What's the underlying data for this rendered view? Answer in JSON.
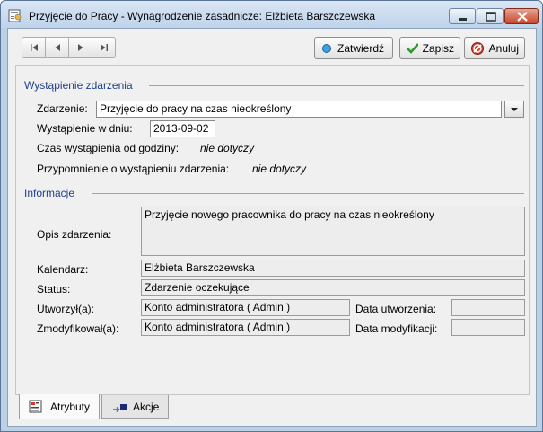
{
  "window": {
    "title": "Przyjęcie do Pracy - Wynagrodzenie zasadnicze:  Elżbieta Barszczewska",
    "minimize_icon": "minimize-icon",
    "maximize_icon": "maximize-icon",
    "close_icon": "close-icon"
  },
  "toolbar": {
    "confirm_label": "Zatwierdź",
    "save_label": "Zapisz",
    "cancel_label": "Anuluj"
  },
  "occurrence": {
    "section_title": "Wystąpienie zdarzenia",
    "event_label": "Zdarzenie:",
    "event_value": "Przyjęcie do pracy na czas nieokreślony",
    "date_label": "Wystąpienie w dniu:",
    "date_value": "2013-09-02",
    "time_label": "Czas wystąpienia od godziny:",
    "time_value": "nie dotyczy",
    "reminder_label": "Przypomnienie o wystąpieniu zdarzenia:",
    "reminder_value": "nie dotyczy"
  },
  "info": {
    "section_title": "Informacje",
    "description_label": "Opis zdarzenia:",
    "description_value": "Przyjęcie nowego pracownika do pracy na czas nieokreślony",
    "calendar_label": "Kalendarz:",
    "calendar_value": "Elżbieta Barszczewska",
    "status_label": "Status:",
    "status_value": "Zdarzenie oczekujące",
    "created_by_label": "Utworzył(a):",
    "created_by_value": "Konto administratora ( Admin )",
    "created_date_label": "Data utworzenia:",
    "created_date_value": "",
    "modified_by_label": "Zmodyfikował(a):",
    "modified_by_value": "Konto administratora ( Admin )",
    "modified_date_label": "Data modyfikacji:",
    "modified_date_value": ""
  },
  "tabs": [
    {
      "label": "Atrybuty"
    },
    {
      "label": "Akcje"
    }
  ]
}
